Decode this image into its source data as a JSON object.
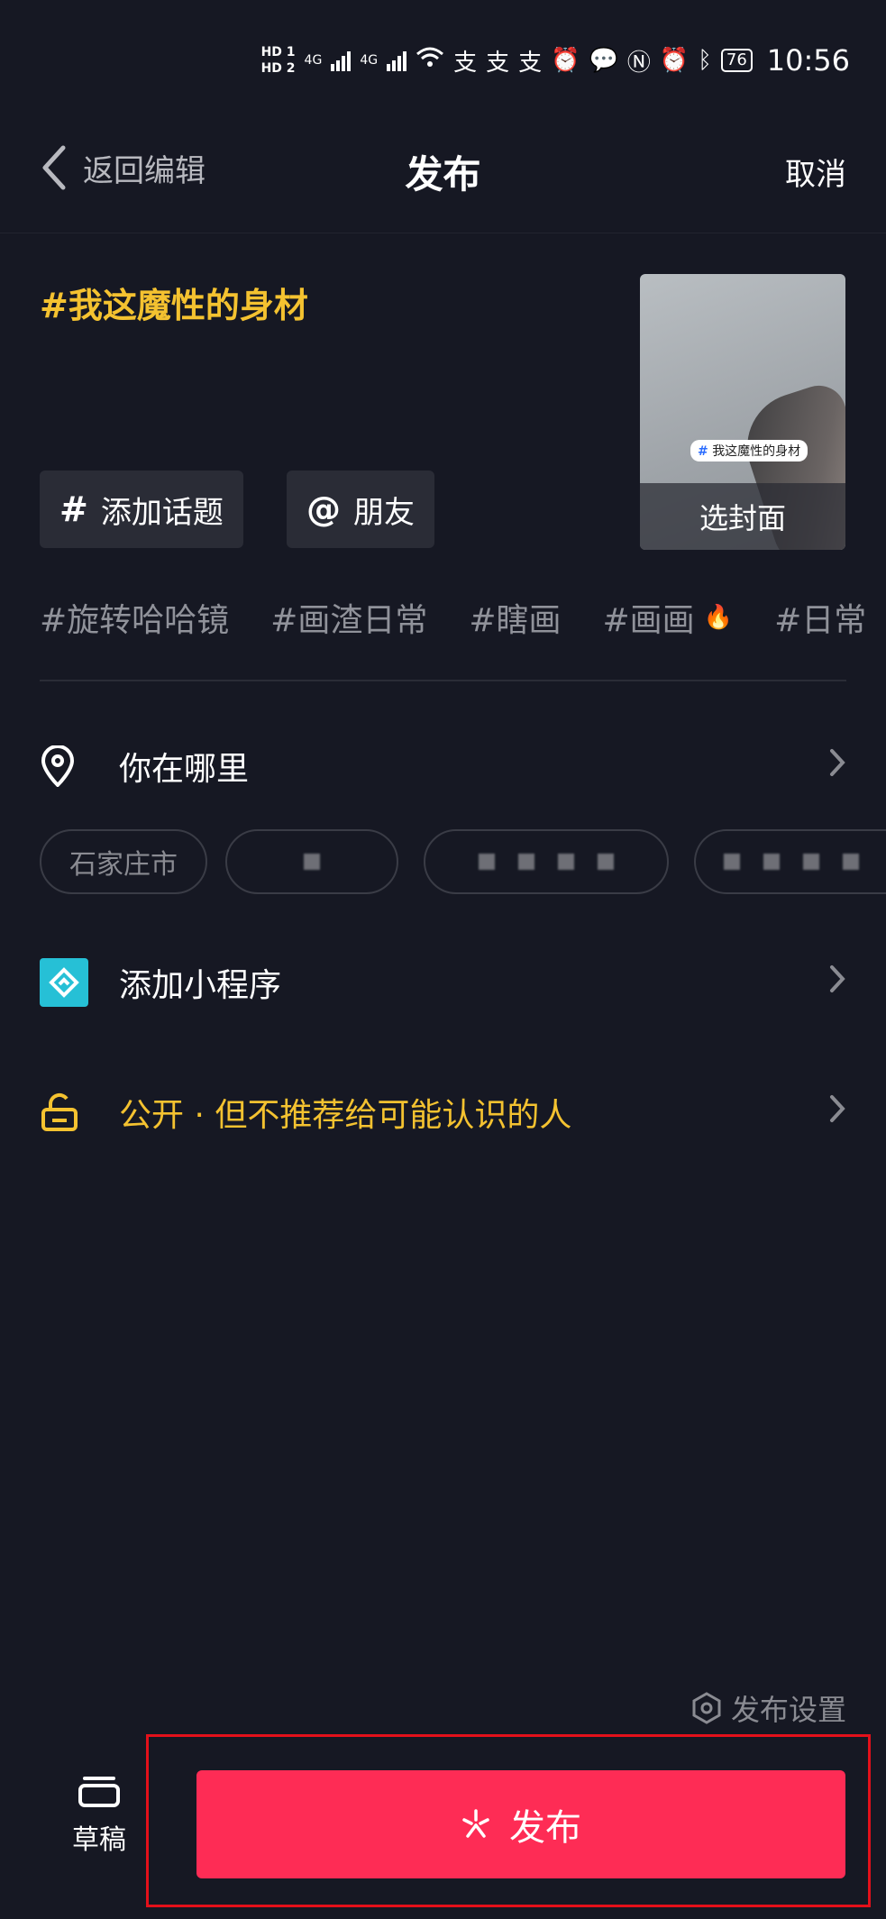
{
  "status_bar": {
    "time": "10:56",
    "battery": "76",
    "hd1": "HD 1",
    "hd2": "HD 2",
    "net1": "4G",
    "net2": "4G"
  },
  "header": {
    "back_label": "返回编辑",
    "title": "发布",
    "cancel_label": "取消"
  },
  "caption": {
    "text": "#我这魔性的身材"
  },
  "chips": {
    "topic": "添加话题",
    "friend": "朋友"
  },
  "cover": {
    "label": "选封面",
    "overlay_tag": "我这魔性的身材"
  },
  "suggested_topics": [
    "#旋转哈哈镜",
    "#画渣日常",
    "#瞎画",
    "#画画",
    "#日常"
  ],
  "location": {
    "label": "你在哪里",
    "chips": [
      "石家庄市"
    ]
  },
  "mini_program": {
    "label": "添加小程序"
  },
  "privacy": {
    "label": "公开 · 但不推荐给可能认识的人"
  },
  "bottom": {
    "settings_label": "发布设置",
    "draft_label": "草稿",
    "publish_label": "发布"
  },
  "colors": {
    "background": "#161823",
    "accent_yellow": "#f4c230",
    "publish_red": "#fe2c55",
    "mini_program_teal": "#26c0d6",
    "highlight_box": "#e3101a"
  }
}
